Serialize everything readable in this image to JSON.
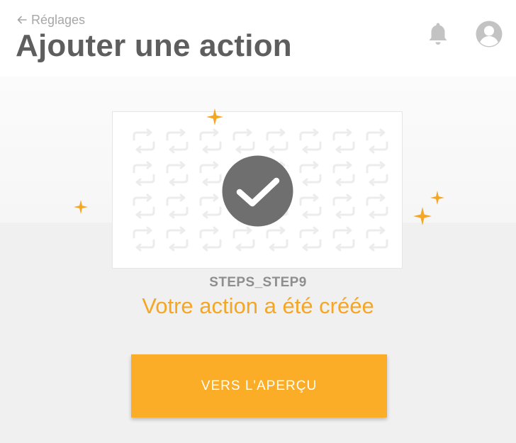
{
  "header": {
    "back_label": "Réglages",
    "title": "Ajouter une action",
    "icons": [
      "arrow-left-icon",
      "bell-icon",
      "user-avatar-icon"
    ]
  },
  "confirmation": {
    "step_key": "STEPS_STEP9",
    "message": "Votre action a été créée",
    "icon": "checkmark-icon",
    "pattern_icon": "repeat-arrows-icon"
  },
  "cta": {
    "label": "VERS L'APERÇU"
  },
  "colors": {
    "accent": "#fbad27",
    "message": "#f5a623",
    "title": "#5e5e5e",
    "check_circle": "#6f6f6f",
    "background": "#f0f0f0"
  }
}
